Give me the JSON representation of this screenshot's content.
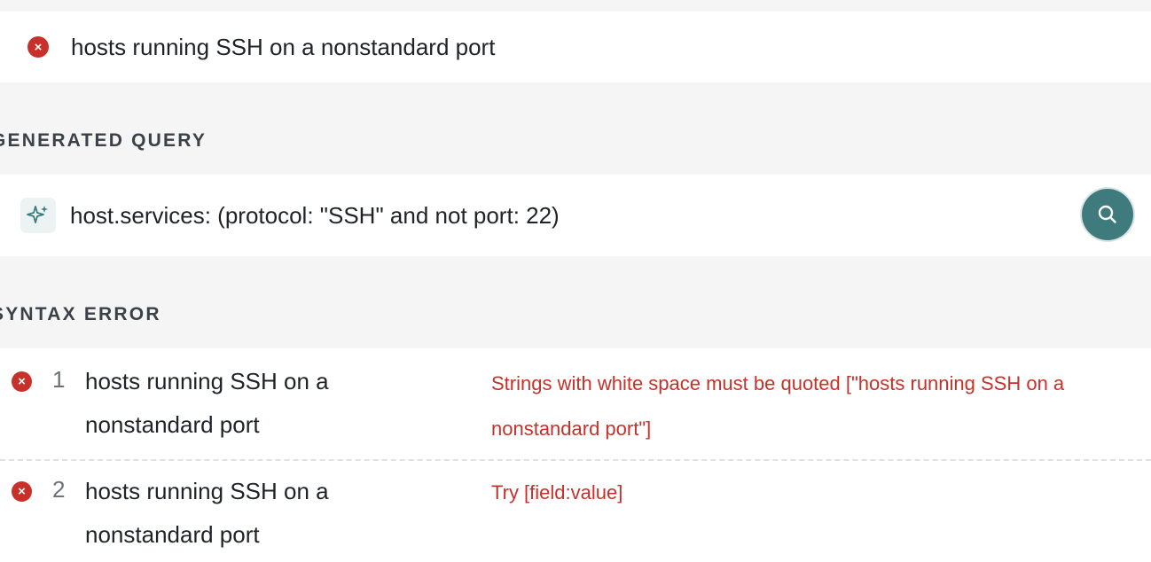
{
  "query_input": {
    "status_icon": "error-circle-x-icon",
    "text": "hosts running SSH on a nonstandard port"
  },
  "generated_query": {
    "heading": "GENERATED QUERY",
    "icon": "sparkle-icon",
    "text": "host.services: (protocol: \"SSH\" and not port: 22)",
    "search_button_icon": "search-icon"
  },
  "syntax_error": {
    "heading": "SYNTAX ERROR",
    "rows": [
      {
        "line": "1",
        "text": "hosts running SSH on a nonstandard port",
        "message": "Strings with white space must be quoted [\"hosts running SSH on a nonstandard port\"]"
      },
      {
        "line": "2",
        "text": "hosts running SSH on a nonstandard port",
        "message": "Try [field:value]"
      }
    ]
  },
  "colors": {
    "background": "#f4f5f4",
    "error": "#c8312a",
    "accent": "#3f7b7d",
    "text": "#1f2328"
  }
}
